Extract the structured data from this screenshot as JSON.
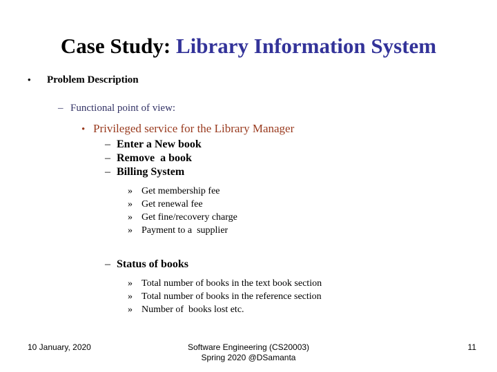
{
  "slide": {
    "background_color": "#ffffff",
    "title": {
      "prefix": "Case Study: ",
      "prefix_color": "#000000",
      "subject": "Library Information System",
      "subject_color": "#333399"
    },
    "outline": {
      "level1": {
        "bullet": "•",
        "text": "Problem Description",
        "color": "#000000"
      },
      "level2": {
        "bullet": "–",
        "text": "Functional point of view:",
        "color": "#333366"
      },
      "level3": {
        "bullet": "•",
        "text": "Privileged service for the Library Manager",
        "color": "#993A1E"
      },
      "billing_group": {
        "items": [
          {
            "bullet": "–",
            "text": "Enter a New book"
          },
          {
            "bullet": "–",
            "text": "Remove  a book"
          },
          {
            "bullet": "–",
            "text": "Billing System"
          }
        ],
        "subitems": [
          {
            "bullet": "»",
            "text": "Get membership fee"
          },
          {
            "bullet": "»",
            "text": "Get renewal fee"
          },
          {
            "bullet": "»",
            "text": "Get fine/recovery charge"
          },
          {
            "bullet": "»",
            "text": "Payment to a  supplier"
          }
        ]
      },
      "status_group": {
        "heading": {
          "bullet": "–",
          "text": "Status of books"
        },
        "subitems": [
          {
            "bullet": "»",
            "text": "Total number of books in the text book section"
          },
          {
            "bullet": "»",
            "text": "Total number of books in the reference section"
          },
          {
            "bullet": "»",
            "text": "Number of  books lost etc."
          }
        ]
      }
    },
    "footer": {
      "date": "10 January, 2020",
      "center_line1": "Software Engineering (CS20003)",
      "center_line2": "Spring 2020 @DSamanta",
      "page_number": "11"
    }
  }
}
